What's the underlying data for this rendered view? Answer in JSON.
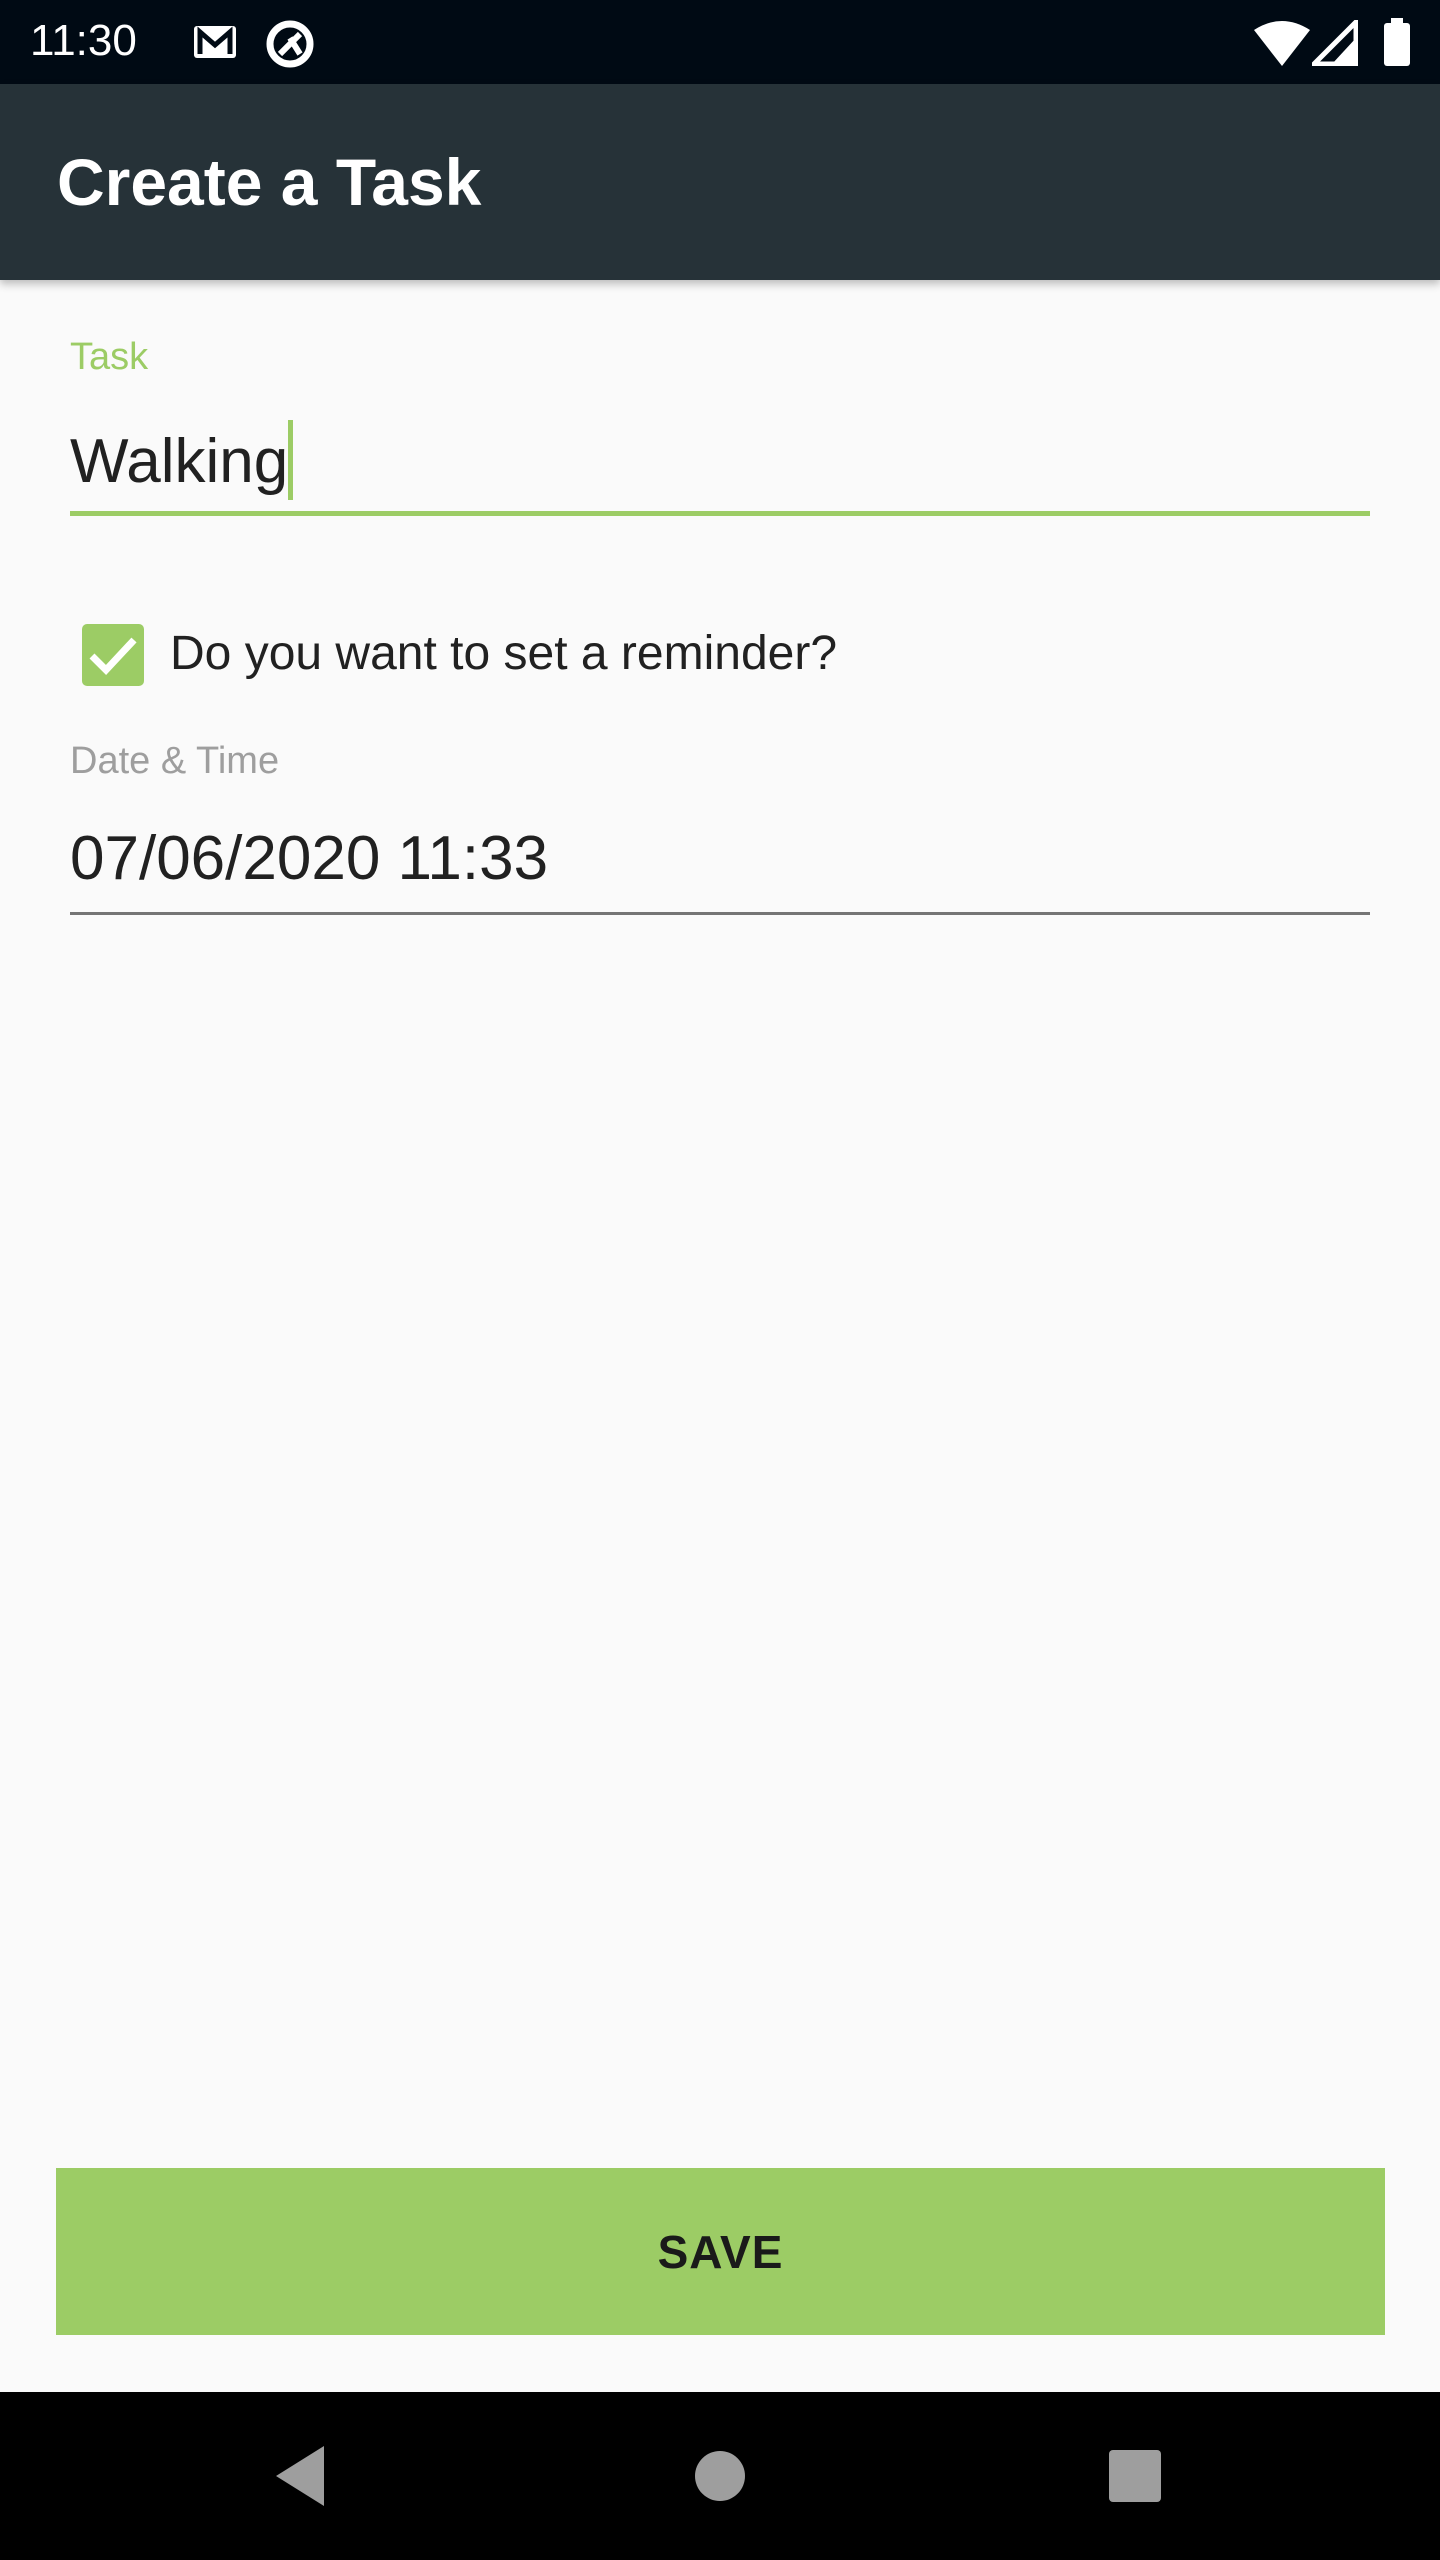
{
  "status_bar": {
    "time": "11:30",
    "icons": [
      "gmail-icon",
      "sync-icon",
      "wifi-icon",
      "signal-icon",
      "battery-icon"
    ]
  },
  "app_bar": {
    "title": "Create a Task"
  },
  "form": {
    "task_label": "Task",
    "task_value": "Walking",
    "reminder_label": "Do you want to set a reminder?",
    "reminder_checked": true,
    "date_label": "Date & Time",
    "date_value": "07/06/2020 11:33"
  },
  "save_label": "SAVE",
  "colors": {
    "accent": "#9ccc65",
    "app_bar": "#263238",
    "status_bar": "#000a14"
  }
}
